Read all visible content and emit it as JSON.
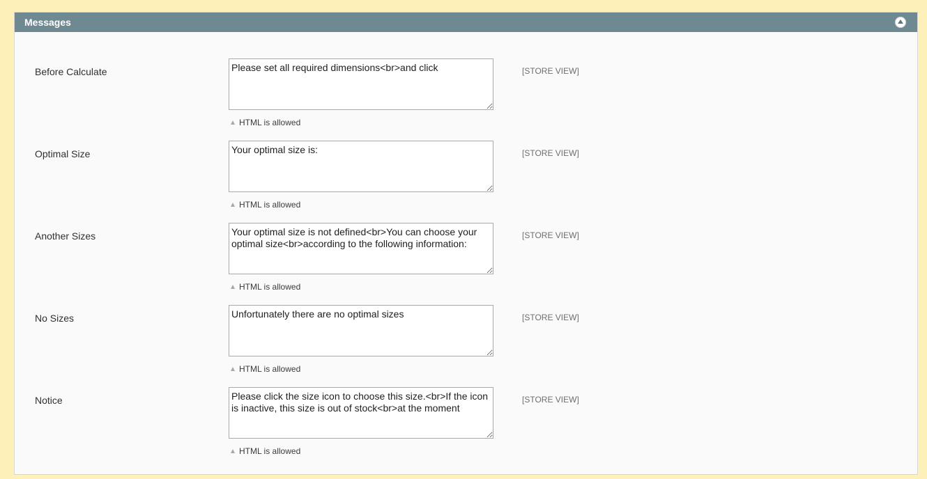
{
  "section": {
    "title": "Messages",
    "collapse_icon": "chevron-up-icon"
  },
  "fields": [
    {
      "label": "Before Calculate",
      "value": "Please set all required dimensions<br>and click",
      "note": "HTML is allowed",
      "scope": "[STORE VIEW]"
    },
    {
      "label": "Optimal Size",
      "value": "Your optimal size is:",
      "note": "HTML is allowed",
      "scope": "[STORE VIEW]"
    },
    {
      "label": "Another Sizes",
      "value": "Your optimal size is not defined<br>You can choose your optimal size<br>according to the following information:",
      "note": "HTML is allowed",
      "scope": "[STORE VIEW]"
    },
    {
      "label": "No Sizes",
      "value": "Unfortunately there are no optimal sizes",
      "note": "HTML is allowed",
      "scope": "[STORE VIEW]"
    },
    {
      "label": "Notice",
      "value": "Please click the size icon to choose this size.<br>If the icon is inactive, this size is out of stock<br>at the moment",
      "note": "HTML is allowed",
      "scope": "[STORE VIEW]"
    }
  ]
}
